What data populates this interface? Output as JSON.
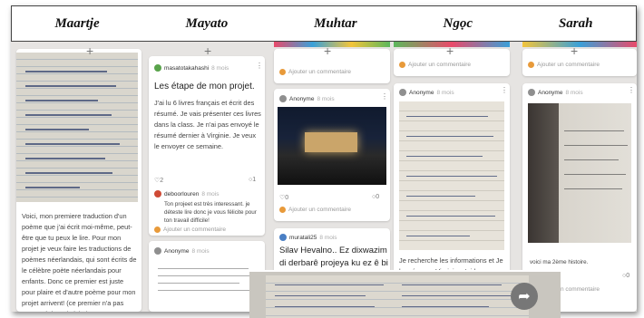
{
  "columns": [
    {
      "title": "Maartje"
    },
    {
      "title": "Mayato"
    },
    {
      "title": "Muhtar"
    },
    {
      "title": "Ngọc"
    },
    {
      "title": "Sarah"
    }
  ],
  "maartje": {
    "post_text": "Voici, mon premiere traduction d'un poème que j'ai écrit moi-même, peut-être que tu peux le lire. Pour mon projet je veux faire les traductions de poèmes néerlandais, qui sont écrits de le célèbre poète néerlandais pour enfants. Donc ce premier est juste pour plaire et d'autre poème pour mon projet arrivent! (ce premier n'a pas encore été corrigé (: des"
  },
  "mayato": {
    "author": "masatotakahashi",
    "ago": "8 mois",
    "title": "Les étape de mon projet.",
    "body": "J'ai lu 6 livres français et écrit des résumé. Je vais présenter ces livres dans la class. Je n'ai pas envoyé le résumé dernier à Virginie. Je veux le envoyer ce semaine.",
    "likes": "2",
    "comments": "1",
    "commenter": "deboorlouren",
    "commenter_ago": "8 mois",
    "comment_text": "Ton projeet est très interessant. je déteste lire donc je vous félicite pour ton travail difficile!",
    "add_comment": "Ajouter un commentaire",
    "author2": "Anonyme",
    "author2_ago": "8 mois"
  },
  "muhtar": {
    "add_comment_top": "Ajouter un commentaire",
    "author": "Anonyme",
    "ago": "8 mois",
    "likes": "0",
    "comments": "0",
    "add_comment": "Ajouter un commentaire",
    "author2": "muratali25",
    "author2_ago": "8 mois",
    "kurdish_text": "Silav Hevalno.. Ez dixwazim di derbarê projeya ku ez ê bi Virginia re bikim de hin"
  },
  "ngoc": {
    "add_comment_top": "Ajouter un commentaire",
    "author": "Anonyme",
    "ago": "8 mois",
    "post_text": "Je recherche les informations et Je les résume. Virginia m'aidez pour"
  },
  "sarah": {
    "add_comment_top": "Ajouter un commentaire",
    "author": "Anonyme",
    "ago": "8 mois",
    "caption": "voici ma 2ème histoire.",
    "comments": "0",
    "add_comment_bottom": "Ajouter un commentaire"
  },
  "icons": {
    "plus": "+",
    "share": "➦",
    "kebab": "⋮",
    "heart": "♡",
    "comment": "○"
  }
}
